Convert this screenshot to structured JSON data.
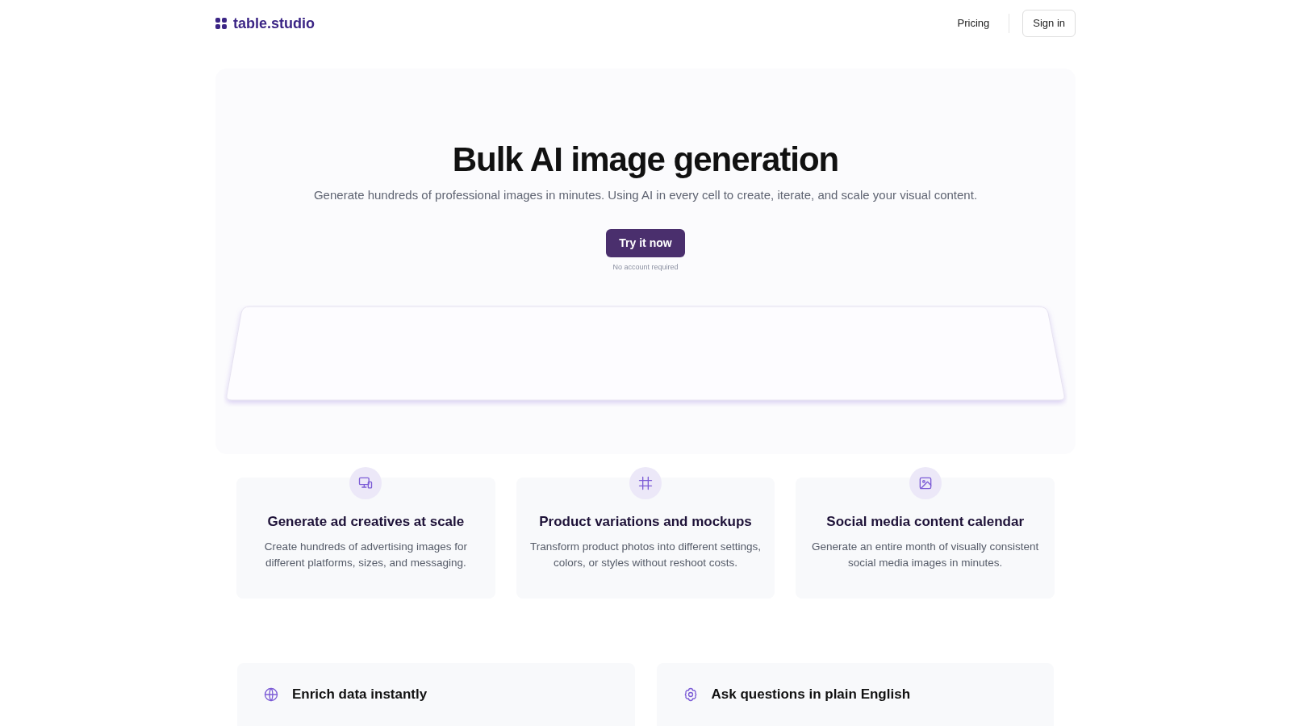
{
  "header": {
    "logo": "table.studio",
    "nav": [
      "Pricing"
    ],
    "sign_in": "Sign in"
  },
  "hero": {
    "title": "Bulk AI image generation",
    "subtitle": "Generate hundreds of professional images in minutes. Using AI in every cell to create, iterate, and scale your visual content.",
    "cta": "Try it now",
    "note": "No account required"
  },
  "use_cases": [
    {
      "kind": "devices",
      "title": "Generate ad creatives at scale",
      "text": "Create hundreds of advertising images for different platforms, sizes, and messaging."
    },
    {
      "kind": "crop",
      "title": "Product variations and mockups",
      "text": "Transform product photos into different settings, colors, or styles without reshoot costs."
    },
    {
      "kind": "image",
      "title": "Social media content calendar",
      "text": "Generate an entire month of visually consistent social media images in minutes."
    }
  ],
  "features": [
    {
      "kind": "globe",
      "title": "Enrich data instantly"
    },
    {
      "kind": "flower",
      "title": "Ask questions in plain English"
    }
  ]
}
